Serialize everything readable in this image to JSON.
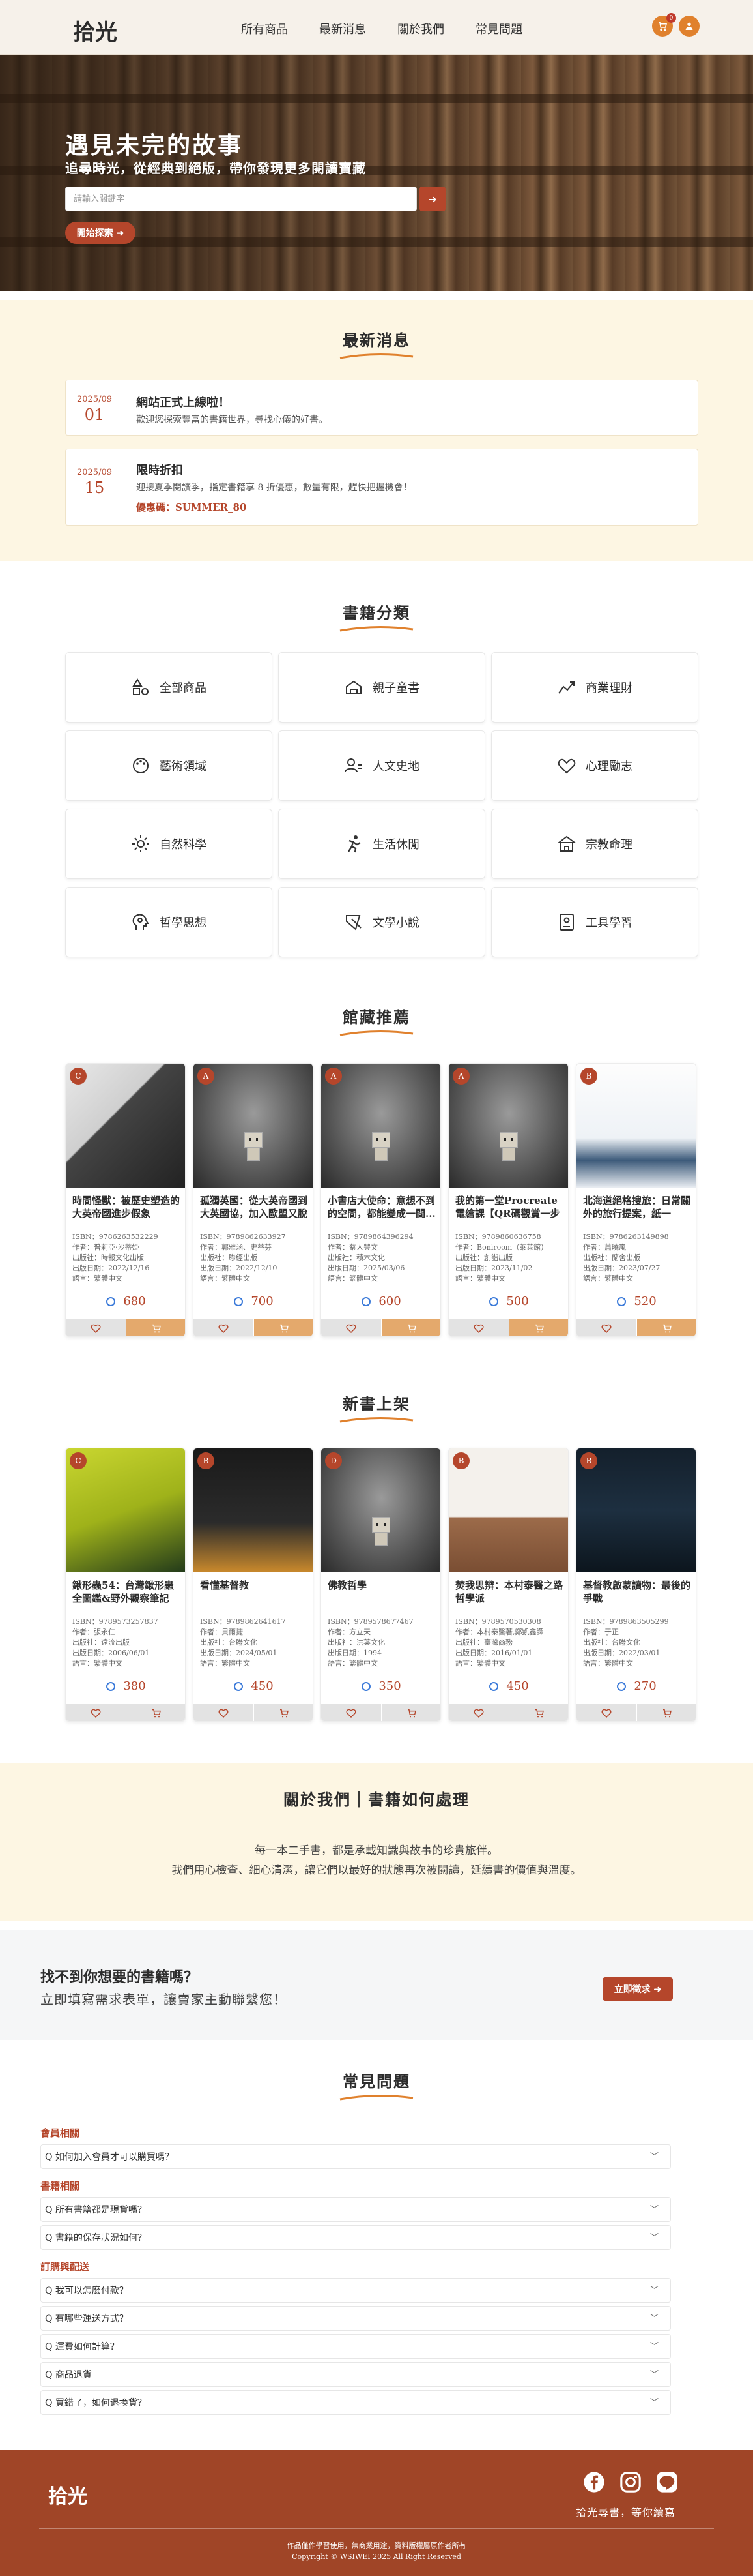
{
  "nav": {
    "logo": "拾光",
    "links": [
      "所有商品",
      "最新消息",
      "關於我們",
      "常見問題"
    ],
    "cart_count": "0",
    "cart_icon": "cart-icon",
    "user_icon": "user-icon"
  },
  "hero": {
    "title": "遇見未完的故事",
    "subtitle": "追尋時光，從經典到絕版，帶你發現更多閱讀寶藏",
    "search_placeholder": "請輸入關鍵字",
    "cta": "開始探索 ➜"
  },
  "news": {
    "title": "最新消息",
    "items": [
      {
        "month": "2025/09",
        "day": "01",
        "title": "網站正式上線啦！",
        "body": "歡迎您探索豐富的書籍世界，尋找心儀的好書。"
      },
      {
        "month": "2025/09",
        "day": "15",
        "title": "限時折扣",
        "body": "迎接夏季閱讀季，指定書籍享 8 折優惠，數量有限，趕快把握機會！",
        "code": "優惠碼：SUMMER_80"
      }
    ]
  },
  "categories": {
    "title": "書籍分類",
    "items": [
      "全部商品",
      "親子童書",
      "商業理財",
      "藝術領域",
      "人文史地",
      "心理勵志",
      "自然科學",
      "生活休閒",
      "宗教命理",
      "哲學思想",
      "文學小說",
      "工具學習"
    ]
  },
  "featured": {
    "title": "館藏推薦",
    "books": [
      {
        "grade": "C",
        "title": "時間怪獸：被歷史塑造的大英帝國進步假象",
        "isbn": "ISBN：9786263532229",
        "author": "作者：普莉亞·沙蒂婭",
        "publisher": "出版社：時報文化出版",
        "date": "出版日期：2022/12/16",
        "lang": "語言：繁體中文",
        "price": "680",
        "cart_style": "orange"
      },
      {
        "grade": "A",
        "title": "孤獨英國：從大英帝國到大英國協，加入歐盟又脫歐",
        "isbn": "ISBN：9789862633927",
        "author": "作者：郭雅涵、史蒂芬",
        "publisher": "出版社：聯經出版",
        "date": "出版日期：2022/12/10",
        "lang": "語言：繁體中文",
        "price": "700",
        "cart_style": "orange"
      },
      {
        "grade": "A",
        "title": "小書店大使命：意想不到的空間，都能變成一間...",
        "isbn": "ISBN：9789864396294",
        "author": "作者：蔡人豐文",
        "publisher": "出版社：積木文化",
        "date": "出版日期：2025/03/06",
        "lang": "語言：繁體中文",
        "price": "600",
        "cart_style": "orange"
      },
      {
        "grade": "A",
        "title": "我的第一堂Procreate電繪課【QR碼觀賞一步一步教學】",
        "isbn": "ISBN：9789860636758",
        "author": "作者：Boniroom（萊萊館）",
        "publisher": "出版社：創詣出版",
        "date": "出版日期：2023/11/02",
        "lang": "語言：繁體中文",
        "price": "500",
        "cart_style": "orange"
      },
      {
        "grade": "B",
        "title": "北海道絕格搜旅：日常關外的旅行提案，紙一",
        "isbn": "ISBN：9786263149898",
        "author": "作者：蕭曉嵐",
        "publisher": "出版社：蘭舍出版",
        "date": "出版日期：2023/07/27",
        "lang": "語言：繁體中文",
        "price": "520",
        "cart_style": "orange"
      }
    ]
  },
  "new_arrivals": {
    "title": "新書上架",
    "books": [
      {
        "grade": "C",
        "title": "鍬形蟲54：台灣鍬形蟲全圖鑑&野外觀察筆記",
        "isbn": "ISBN：9789573257837",
        "author": "作者：張永仁",
        "publisher": "出版社：遠流出版",
        "date": "出版日期：2006/06/01",
        "lang": "語言：繁體中文",
        "price": "380",
        "cart_style": "grey"
      },
      {
        "grade": "B",
        "title": "看懂基督教",
        "isbn": "ISBN：9789862641617",
        "author": "作者：貝爾捷",
        "publisher": "出版社：台聯文化",
        "date": "出版日期：2024/05/01",
        "lang": "語言：繁體中文",
        "price": "450",
        "cart_style": "grey"
      },
      {
        "grade": "D",
        "title": "佛教哲學",
        "isbn": "ISBN：9789578677467",
        "author": "作者：方立天",
        "publisher": "出版社：洪葉文化",
        "date": "出版日期：1994",
        "lang": "語言：繁體中文",
        "price": "350",
        "cart_style": "grey"
      },
      {
        "grade": "B",
        "title": "焚我思辨：本村泰醫之路哲學派",
        "isbn": "ISBN：9789570530308",
        "author": "作者：本村泰醫著,鄭凱鑫譯",
        "publisher": "出版社：臺灣商務",
        "date": "出版日期：2016/01/01",
        "lang": "語言：繁體中文",
        "price": "450",
        "cart_style": "grey"
      },
      {
        "grade": "B",
        "title": "基督教啟蒙讀物：最後的爭戰",
        "isbn": "ISBN：9789863505299",
        "author": "作者：于正",
        "publisher": "出版社：台聯文化",
        "date": "出版日期：2022/03/01",
        "lang": "語言：繁體中文",
        "price": "270",
        "cart_style": "grey"
      }
    ]
  },
  "about": {
    "title": "關於我們｜書籍如何處理",
    "line1": "每一本二手書，都是承載知識與故事的珍貴旅伴。",
    "line2": "我們用心檢查、細心清潔，讓它們以最好的狀態再次被閱讀，延續書的價值與溫度。"
  },
  "cta": {
    "title": "找不到你想要的書籍嗎？",
    "subtitle": "立即填寫需求表單，讓賣家主動聯繫您！",
    "button": "立即徵求 ➜"
  },
  "faq": {
    "title": "常見問題",
    "groups": [
      {
        "name": "會員相關",
        "items": [
          "Q 如何加入會員才可以購買嗎？"
        ]
      },
      {
        "name": "書籍相關",
        "items": [
          "Q 所有書籍都是現貨嗎？",
          "Q 書籍的保存狀況如何？"
        ]
      },
      {
        "name": "訂購與配送",
        "items": [
          "Q 我可以怎麼付款？",
          "Q 有哪些運送方式？",
          "Q 運費如何計算？",
          "Q 商品退貨",
          "Q 買錯了，如何退換貨？"
        ]
      }
    ]
  },
  "footer": {
    "logo": "拾光",
    "tagline": "拾光尋書，等你續寫",
    "legal1": "作品僅作學習使用，無商業用途，資料版權屬原作者所有",
    "legal2": "Copyright © WSIWEI 2025 All Right Reserved",
    "social_icons": [
      "facebook-icon",
      "instagram-icon",
      "line-icon"
    ]
  },
  "colors": {
    "accent": "#b5462b",
    "orange": "#e0812d",
    "cream": "#fdf6e3"
  }
}
